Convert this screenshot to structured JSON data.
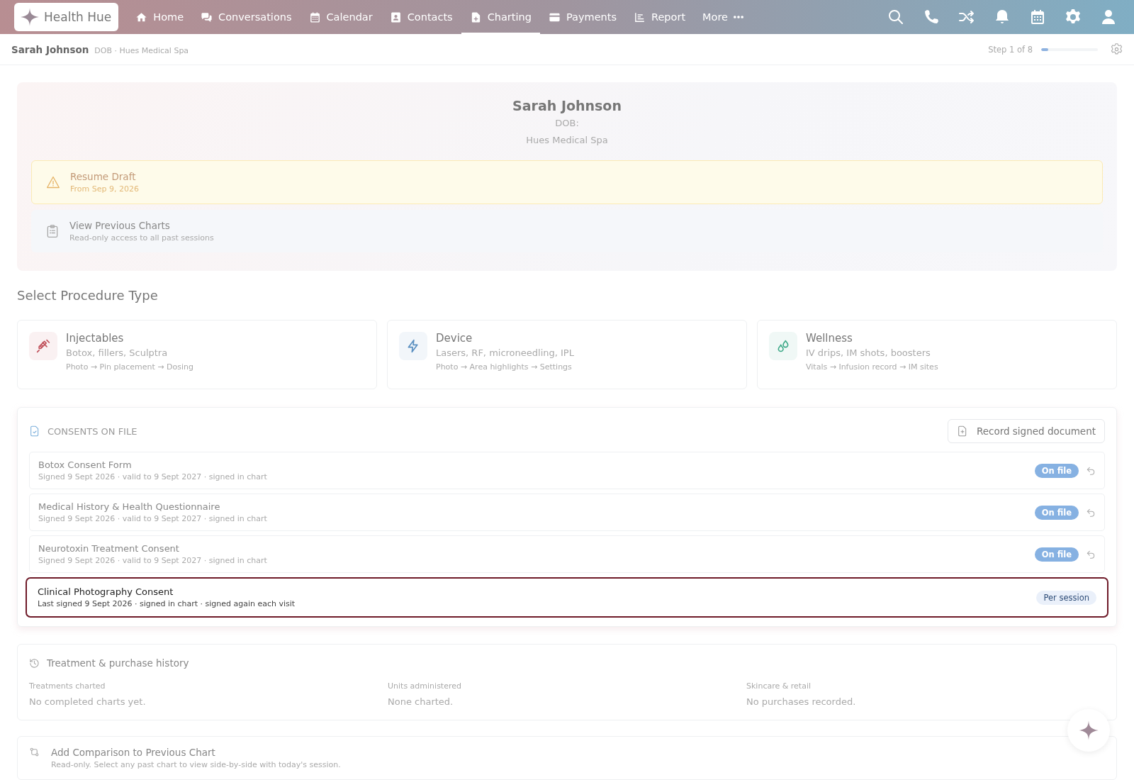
{
  "brand": {
    "name": "Health Hue"
  },
  "nav": [
    {
      "label": "Home",
      "selected": false
    },
    {
      "label": "Conversations",
      "selected": false
    },
    {
      "label": "Calendar",
      "selected": false
    },
    {
      "label": "Contacts",
      "selected": false
    },
    {
      "label": "Charting",
      "selected": true
    },
    {
      "label": "Payments",
      "selected": false
    },
    {
      "label": "Report",
      "selected": false
    },
    {
      "label": "More",
      "selected": false
    }
  ],
  "subheader": {
    "patient": "Sarah Johnson",
    "meta": "DOB · Hues Medical Spa",
    "step": "Step 1 of 8",
    "level": 0.125
  },
  "patient_card": {
    "name": "Sarah Johnson",
    "dob": "DOB:",
    "clinic": "Hues Medical Spa",
    "actions": [
      {
        "kind": "warning",
        "title": "Resume Draft",
        "subtitle": "From Sep 9, 2026"
      },
      {
        "kind": "neutral",
        "title": "View Previous Charts",
        "subtitle": "Read-only access to all past sessions"
      }
    ]
  },
  "procedure_heading": "Select Procedure Type",
  "procedures": [
    {
      "color": "#c0505a",
      "title": "Injectables",
      "subtitle": "Botox, fillers, Sculptra",
      "steps": "Photo → Pin placement → Dosing"
    },
    {
      "color": "#5a8fc0",
      "title": "Device",
      "subtitle": "Lasers, RF, microneedling, IPL",
      "steps": "Photo → Area highlights → Settings"
    },
    {
      "color": "#3aa886",
      "title": "Wellness",
      "subtitle": "IV drips, IM shots, boosters",
      "steps": "Vitals → Infusion record → IM sites"
    }
  ],
  "consents": {
    "title": "CONSENTS ON FILE",
    "button": "Record signed document",
    "items": [
      {
        "title": "Botox Consent Form",
        "detail": "Signed 9 Sept 2026 · valid to 9 Sept 2027 · signed in chart",
        "badge": "On file",
        "kind": "on_file",
        "selected": false
      },
      {
        "title": "Medical History & Health Questionnaire",
        "detail": "Signed 9 Sept 2026 · valid to 9 Sept 2027 · signed in chart",
        "badge": "On file",
        "kind": "on_file",
        "selected": false
      },
      {
        "title": "Neurotoxin Treatment Consent",
        "detail": "Signed 9 Sept 2026 · valid to 9 Sept 2027 · signed in chart",
        "badge": "On file",
        "kind": "on_file",
        "selected": false
      },
      {
        "title": "Clinical Photography Consent",
        "detail": "Last signed 9 Sept 2026 · signed in chart · signed again each visit",
        "badge": "Per session",
        "kind": "per_session",
        "selected": true
      }
    ]
  },
  "history": {
    "title": "Treatment & purchase history",
    "columns": [
      {
        "label": "Treatments charted",
        "value": "No completed charts yet."
      },
      {
        "label": "Units administered",
        "value": "None charted."
      },
      {
        "label": "Skincare & retail",
        "value": "No purchases recorded."
      }
    ]
  },
  "comparison": {
    "title": "Add Comparison to Previous Chart",
    "subtitle": "Read-only. Select any past chart to view side-by-side with today's session."
  }
}
